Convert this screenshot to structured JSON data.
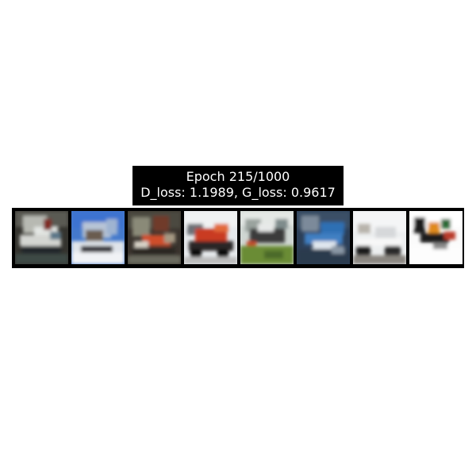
{
  "figure": {
    "title_line1": "Epoch 215/1000",
    "title_line2": "D_loss: 1.1989, G_loss: 0.9617"
  },
  "samples": [
    {
      "label": "generated-sample-1",
      "dominant_colors": [
        "#2b2b2b",
        "#d8dcd8",
        "#3a3f40"
      ]
    },
    {
      "label": "generated-sample-2",
      "dominant_colors": [
        "#3d72c9",
        "#e8ecf2",
        "#5d4e44"
      ]
    },
    {
      "label": "generated-sample-3",
      "dominant_colors": [
        "#3a302a",
        "#d0502c",
        "#6e7463"
      ]
    },
    {
      "label": "generated-sample-4",
      "dominant_colors": [
        "#e9ecef",
        "#cc3a23",
        "#252525"
      ]
    },
    {
      "label": "generated-sample-5",
      "dominant_colors": [
        "#d7ddd8",
        "#6a8a38",
        "#333333"
      ]
    },
    {
      "label": "generated-sample-6",
      "dominant_colors": [
        "#2b4566",
        "#2f6fb3",
        "#dfe6ec"
      ]
    },
    {
      "label": "generated-sample-7",
      "dominant_colors": [
        "#f1f2f3",
        "#222222",
        "#a09a93"
      ]
    },
    {
      "label": "generated-sample-8",
      "dominant_colors": [
        "#ffffff",
        "#e08a1a",
        "#1a1a1a"
      ]
    }
  ]
}
